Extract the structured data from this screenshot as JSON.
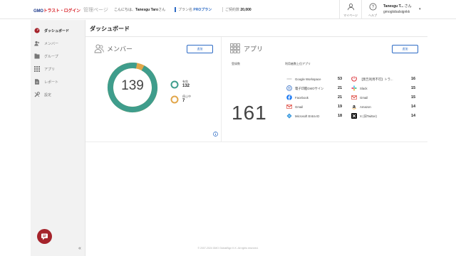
{
  "header": {
    "logo_gmo": "GMO",
    "logo_rest": "トラスト・ログイン",
    "admin_label": "管理ページ",
    "greeting_prefix": "こんにちは、",
    "greeting_name": "Tanesgu Taro",
    "greeting_suffix": "さん",
    "plan_label": "プラン名",
    "plan_value": "PROプラン",
    "contract_label": "ご契約数",
    "contract_value": "20,000",
    "mypage_label": "マイページ",
    "help_label": "ヘルプ",
    "user_name": "Tanesgu T...",
    "user_suffix": "さん",
    "user_org": "gmoglobalsignkk"
  },
  "sidebar": {
    "items": [
      {
        "label": "ダッシュボード",
        "icon": "dashboard-icon"
      },
      {
        "label": "メンバー",
        "icon": "members-icon"
      },
      {
        "label": "グループ",
        "icon": "group-icon"
      },
      {
        "label": "アプリ",
        "icon": "apps-icon"
      },
      {
        "label": "レポート",
        "icon": "report-icon"
      },
      {
        "label": "設定",
        "icon": "settings-icon"
      }
    ],
    "collapse_label": "«"
  },
  "page": {
    "title": "ダッシュボード"
  },
  "members": {
    "title": "メンバー",
    "button": "追加",
    "total": "139",
    "active_label": "有効",
    "active_count": "132",
    "stopped_label": "停止中",
    "stopped_count": "7",
    "active_fraction": 0.9496,
    "colors": {
      "active": "#3f9d8c",
      "stopped": "#e1a64a"
    },
    "info_icon": "info-icon"
  },
  "apps": {
    "title": "アプリ",
    "button": "追加",
    "registered_label": "登録数",
    "registered_count": "161",
    "ranking_label": "利用者数上位アプリ",
    "left": [
      {
        "name": "Google Workspace",
        "count": "53",
        "icon": "google-workspace-icon",
        "color": "#aaaaaa"
      },
      {
        "name": "電子印鑑GMOサイン",
        "count": "21",
        "icon": "gmo-sign-icon",
        "color": "#2d6bc5"
      },
      {
        "name": "Facebook",
        "count": "21",
        "icon": "facebook-icon",
        "color": "#1877f2"
      },
      {
        "name": "Gmail",
        "count": "19",
        "icon": "gmail-icon",
        "color": "#d93025"
      },
      {
        "name": "Microsoft Entra ID",
        "count": "18",
        "icon": "entra-id-icon",
        "color": "#2f8fd8"
      }
    ],
    "right": [
      {
        "name": "【無告利用不可】トラ...",
        "count": "16",
        "icon": "trustlogin-icon",
        "color": "#d8232a"
      },
      {
        "name": "Slack",
        "count": "15",
        "icon": "slack-icon",
        "color": "#4a154b"
      },
      {
        "name": "Gmail",
        "count": "15",
        "icon": "gmail-icon",
        "color": "#d93025"
      },
      {
        "name": "Amazon",
        "count": "14",
        "icon": "amazon-icon",
        "color": "#111111"
      },
      {
        "name": "X (旧Twitter)",
        "count": "14",
        "icon": "x-icon",
        "color": "#111111"
      }
    ]
  },
  "footer": {
    "copyright": "© 2007-2024 GMO GlobalSign K.K. All rights reserved."
  }
}
